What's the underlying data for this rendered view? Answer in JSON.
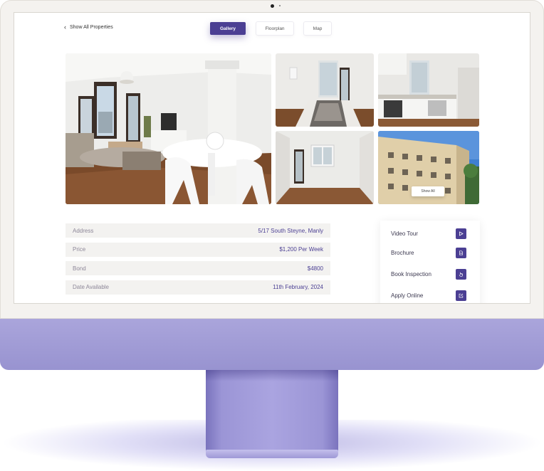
{
  "nav": {
    "back_label": "Show All Properties"
  },
  "tabs": [
    {
      "label": "Gallery",
      "active": true
    },
    {
      "label": "Floorplan",
      "active": false
    },
    {
      "label": "Map",
      "active": false
    }
  ],
  "gallery": {
    "show_all_label": "Show All"
  },
  "details": [
    {
      "label": "Address",
      "value": "5/17 South Steyne, Manly"
    },
    {
      "label": "Price",
      "value": "$1,200 Per Week"
    },
    {
      "label": "Bond",
      "value": "$4800"
    },
    {
      "label": "Date Available",
      "value": "11th February, 2024"
    }
  ],
  "actions": [
    {
      "label": "Video Tour",
      "icon": "play-icon"
    },
    {
      "label": "Brochure",
      "icon": "document-icon"
    },
    {
      "label": "Book Inspection",
      "icon": "hand-pointer-icon"
    },
    {
      "label": "Apply Online",
      "icon": "edit-icon"
    }
  ],
  "colors": {
    "accent": "#4b3f93",
    "chin": "#a29ed8",
    "row_background": "#f3f2f0"
  }
}
